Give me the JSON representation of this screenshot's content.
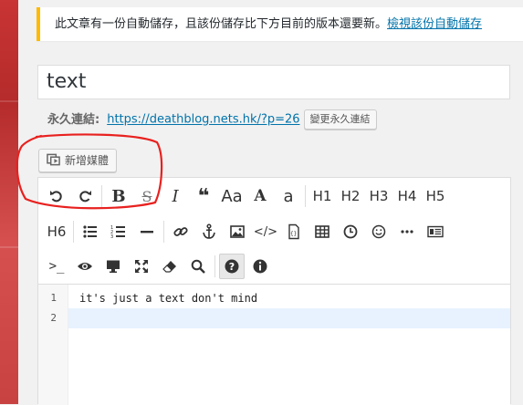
{
  "notice": {
    "message": "此文章有一份自動儲存，且該份儲存比下方目前的版本還要新。",
    "link_label": "檢視該份自動儲存",
    "accent_color": "#ffb900"
  },
  "post": {
    "title": "text"
  },
  "permalink": {
    "label": "永久連結:",
    "url": "https://deathblog.nets.hk/?p=26",
    "edit_button": "變更永久連結"
  },
  "media": {
    "button_label": "新增媒體"
  },
  "toolbar": {
    "row1": [
      "undo-icon",
      "redo-icon",
      "bold-icon",
      "strikethrough-icon",
      "italic-icon",
      "quote-icon",
      "font-size-icon",
      "font-color-icon",
      "letter-a-icon",
      "H1",
      "H2",
      "H3",
      "H4",
      "H5"
    ],
    "headings": {
      "h1": "H1",
      "h2": "H2",
      "h3": "H3",
      "h4": "H4",
      "h5": "H5",
      "h6": "H6"
    },
    "active_item": "help-icon"
  },
  "code": {
    "lines": [
      {
        "number": "1",
        "text": "it's just a text don't mind"
      },
      {
        "number": "2",
        "text": ""
      }
    ],
    "active_line": "2",
    "active_color": "#e8f2ff"
  },
  "annotation": {
    "color": "#e8211f"
  }
}
